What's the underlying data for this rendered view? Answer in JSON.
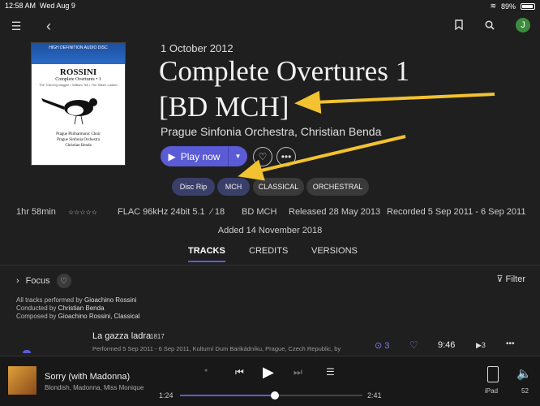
{
  "status": {
    "time": "12:58 AM",
    "date": "Wed Aug 9",
    "battery": "89%"
  },
  "nav": {
    "avatar_initial": "J"
  },
  "cover": {
    "label": "HIGH DEFINITION AUDIO DISC",
    "composer": "ROSSINI",
    "work": "Complete Overtures • 1",
    "pieces": "The Thieving Magpie • William Tell • The Silken Ladder",
    "performers": "Prague Philharmonic Choir\nPrague Sinfonia Orchestra\nChristian Benda"
  },
  "album": {
    "date": "1 October 2012",
    "title_line1": "Complete Overtures 1",
    "title_line2": "[BD MCH]",
    "artist": "Prague Sinfonia Orchestra, Christian Benda",
    "play_label": "Play now"
  },
  "tags": [
    "Disc Rip",
    "MCH",
    "CLASSICAL",
    "ORCHESTRAL"
  ],
  "info": {
    "duration": "1hr 58min",
    "stars": "☆☆☆☆☆",
    "format": "FLAC 96kHz 24bit 5.1",
    "score": "⁄ 18",
    "source": "BD MCH",
    "released": "Released 28 May 2013",
    "recorded": "Recorded 5 Sep 2011 - 6 Sep 2011",
    "added": "Added 14 November 2018"
  },
  "tabs": [
    "TRACKS",
    "CREDITS",
    "VERSIONS"
  ],
  "focus": {
    "label": "Focus",
    "filter": "Filter"
  },
  "credits": {
    "performed_prefix": "All tracks performed by ",
    "performed": "Gioachino Rossini",
    "conducted_prefix": "Conducted by ",
    "conducted": "Christian Benda",
    "composed_prefix": "Composed by ",
    "composed": "Gioachino Rossini, Classical"
  },
  "track": {
    "title": "La gazza ladra",
    "year": "1817",
    "detail": "Performed 5 Sep 2011 - 6 Sep 2011, Kulturní Dum Barikádníku, Prague, Czech Republic, by",
    "versions": "3",
    "duration": "9:46",
    "plays": "3"
  },
  "player": {
    "song": "Sorry (with Madonna)",
    "artists": "Blondish, Madonna, Miss Monique",
    "elapsed": "1:24",
    "total": "2:41",
    "progress": 0.52,
    "device": "iPad",
    "volume": "52"
  }
}
